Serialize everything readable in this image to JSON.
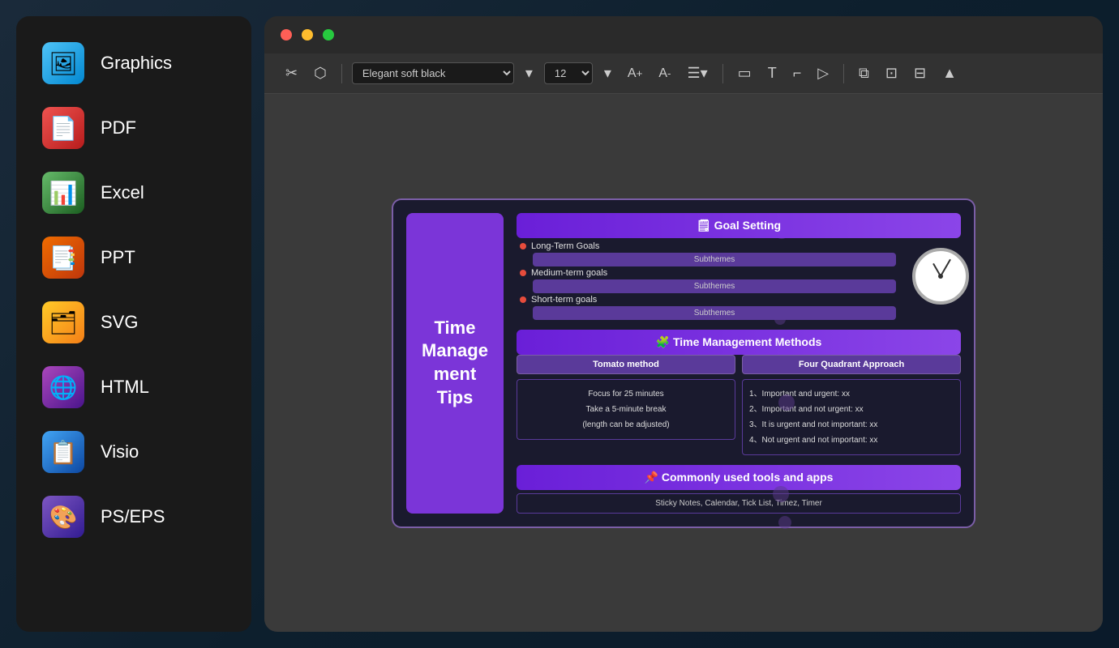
{
  "sidebar": {
    "items": [
      {
        "id": "graphics",
        "label": "Graphics",
        "icon": "🖼",
        "iconClass": "icon-graphics"
      },
      {
        "id": "pdf",
        "label": "PDF",
        "icon": "📄",
        "iconClass": "icon-pdf"
      },
      {
        "id": "excel",
        "label": "Excel",
        "icon": "📊",
        "iconClass": "icon-excel"
      },
      {
        "id": "ppt",
        "label": "PPT",
        "icon": "📑",
        "iconClass": "icon-ppt"
      },
      {
        "id": "svg",
        "label": "SVG",
        "icon": "🗂",
        "iconClass": "icon-svg"
      },
      {
        "id": "html",
        "label": "HTML",
        "icon": "🌐",
        "iconClass": "icon-html"
      },
      {
        "id": "visio",
        "label": "Visio",
        "icon": "📋",
        "iconClass": "icon-visio"
      },
      {
        "id": "pseps",
        "label": "PS/EPS",
        "icon": "🎨",
        "iconClass": "icon-pseps"
      }
    ]
  },
  "toolbar": {
    "font": "Elegant soft black",
    "size": "12",
    "buttons": [
      "✂",
      "⬡"
    ]
  },
  "mindmap": {
    "title": "Time\nManage\nment\nTips",
    "sections": {
      "goalSetting": {
        "header": "🗒 Goal Setting",
        "goals": [
          {
            "label": "Long-Term Goals",
            "subtheme": "Subthemes"
          },
          {
            "label": "Medium-term goals",
            "subtheme": "Subthemes"
          },
          {
            "label": "Short-term goals",
            "subtheme": "Subthemes"
          }
        ]
      },
      "methods": {
        "header": "🧩 Time Management Methods",
        "columns": [
          {
            "header": "Tomato method",
            "items": [
              "Focus for 25 minutes",
              "Take a 5-minute break",
              "(length can be adjusted)"
            ]
          },
          {
            "header": "Four Quadrant Approach",
            "items": [
              "1、Important and urgent: xx",
              "2、Important and not urgent: xx",
              "3、It is urgent and not important: xx",
              "4、Not urgent and not important: xx"
            ]
          }
        ]
      },
      "tools": {
        "header": "📌 Commonly used tools and apps",
        "content": "Sticky Notes, Calendar, Tick List, Timez, Timer"
      }
    }
  }
}
